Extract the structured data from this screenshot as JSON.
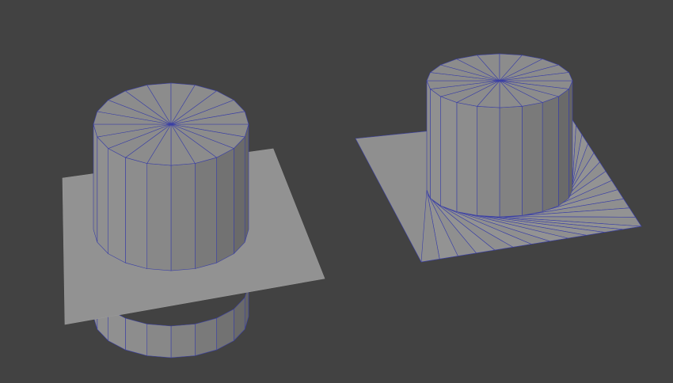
{
  "viewport": {
    "background": "#424242",
    "wire_color": "#3a3fa6",
    "objects": [
      {
        "name": "cylinder-through-plane",
        "type": "cylinder-with-intersecting-plane",
        "segments": 20
      },
      {
        "name": "cylinder-merged-with-plane",
        "type": "cylinder-with-fanned-base-plane",
        "segments": 20
      }
    ]
  }
}
